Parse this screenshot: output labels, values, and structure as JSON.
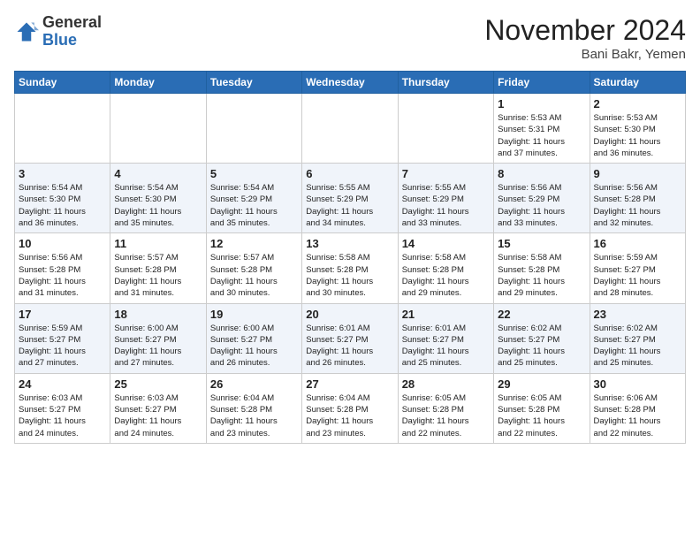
{
  "header": {
    "logo_line1": "General",
    "logo_line2": "Blue",
    "month_title": "November 2024",
    "location": "Bani Bakr, Yemen"
  },
  "weekdays": [
    "Sunday",
    "Monday",
    "Tuesday",
    "Wednesday",
    "Thursday",
    "Friday",
    "Saturday"
  ],
  "weeks": [
    [
      {
        "day": "",
        "info": ""
      },
      {
        "day": "",
        "info": ""
      },
      {
        "day": "",
        "info": ""
      },
      {
        "day": "",
        "info": ""
      },
      {
        "day": "",
        "info": ""
      },
      {
        "day": "1",
        "info": "Sunrise: 5:53 AM\nSunset: 5:31 PM\nDaylight: 11 hours\nand 37 minutes."
      },
      {
        "day": "2",
        "info": "Sunrise: 5:53 AM\nSunset: 5:30 PM\nDaylight: 11 hours\nand 36 minutes."
      }
    ],
    [
      {
        "day": "3",
        "info": "Sunrise: 5:54 AM\nSunset: 5:30 PM\nDaylight: 11 hours\nand 36 minutes."
      },
      {
        "day": "4",
        "info": "Sunrise: 5:54 AM\nSunset: 5:30 PM\nDaylight: 11 hours\nand 35 minutes."
      },
      {
        "day": "5",
        "info": "Sunrise: 5:54 AM\nSunset: 5:29 PM\nDaylight: 11 hours\nand 35 minutes."
      },
      {
        "day": "6",
        "info": "Sunrise: 5:55 AM\nSunset: 5:29 PM\nDaylight: 11 hours\nand 34 minutes."
      },
      {
        "day": "7",
        "info": "Sunrise: 5:55 AM\nSunset: 5:29 PM\nDaylight: 11 hours\nand 33 minutes."
      },
      {
        "day": "8",
        "info": "Sunrise: 5:56 AM\nSunset: 5:29 PM\nDaylight: 11 hours\nand 33 minutes."
      },
      {
        "day": "9",
        "info": "Sunrise: 5:56 AM\nSunset: 5:28 PM\nDaylight: 11 hours\nand 32 minutes."
      }
    ],
    [
      {
        "day": "10",
        "info": "Sunrise: 5:56 AM\nSunset: 5:28 PM\nDaylight: 11 hours\nand 31 minutes."
      },
      {
        "day": "11",
        "info": "Sunrise: 5:57 AM\nSunset: 5:28 PM\nDaylight: 11 hours\nand 31 minutes."
      },
      {
        "day": "12",
        "info": "Sunrise: 5:57 AM\nSunset: 5:28 PM\nDaylight: 11 hours\nand 30 minutes."
      },
      {
        "day": "13",
        "info": "Sunrise: 5:58 AM\nSunset: 5:28 PM\nDaylight: 11 hours\nand 30 minutes."
      },
      {
        "day": "14",
        "info": "Sunrise: 5:58 AM\nSunset: 5:28 PM\nDaylight: 11 hours\nand 29 minutes."
      },
      {
        "day": "15",
        "info": "Sunrise: 5:58 AM\nSunset: 5:28 PM\nDaylight: 11 hours\nand 29 minutes."
      },
      {
        "day": "16",
        "info": "Sunrise: 5:59 AM\nSunset: 5:27 PM\nDaylight: 11 hours\nand 28 minutes."
      }
    ],
    [
      {
        "day": "17",
        "info": "Sunrise: 5:59 AM\nSunset: 5:27 PM\nDaylight: 11 hours\nand 27 minutes."
      },
      {
        "day": "18",
        "info": "Sunrise: 6:00 AM\nSunset: 5:27 PM\nDaylight: 11 hours\nand 27 minutes."
      },
      {
        "day": "19",
        "info": "Sunrise: 6:00 AM\nSunset: 5:27 PM\nDaylight: 11 hours\nand 26 minutes."
      },
      {
        "day": "20",
        "info": "Sunrise: 6:01 AM\nSunset: 5:27 PM\nDaylight: 11 hours\nand 26 minutes."
      },
      {
        "day": "21",
        "info": "Sunrise: 6:01 AM\nSunset: 5:27 PM\nDaylight: 11 hours\nand 25 minutes."
      },
      {
        "day": "22",
        "info": "Sunrise: 6:02 AM\nSunset: 5:27 PM\nDaylight: 11 hours\nand 25 minutes."
      },
      {
        "day": "23",
        "info": "Sunrise: 6:02 AM\nSunset: 5:27 PM\nDaylight: 11 hours\nand 25 minutes."
      }
    ],
    [
      {
        "day": "24",
        "info": "Sunrise: 6:03 AM\nSunset: 5:27 PM\nDaylight: 11 hours\nand 24 minutes."
      },
      {
        "day": "25",
        "info": "Sunrise: 6:03 AM\nSunset: 5:27 PM\nDaylight: 11 hours\nand 24 minutes."
      },
      {
        "day": "26",
        "info": "Sunrise: 6:04 AM\nSunset: 5:28 PM\nDaylight: 11 hours\nand 23 minutes."
      },
      {
        "day": "27",
        "info": "Sunrise: 6:04 AM\nSunset: 5:28 PM\nDaylight: 11 hours\nand 23 minutes."
      },
      {
        "day": "28",
        "info": "Sunrise: 6:05 AM\nSunset: 5:28 PM\nDaylight: 11 hours\nand 22 minutes."
      },
      {
        "day": "29",
        "info": "Sunrise: 6:05 AM\nSunset: 5:28 PM\nDaylight: 11 hours\nand 22 minutes."
      },
      {
        "day": "30",
        "info": "Sunrise: 6:06 AM\nSunset: 5:28 PM\nDaylight: 11 hours\nand 22 minutes."
      }
    ]
  ]
}
